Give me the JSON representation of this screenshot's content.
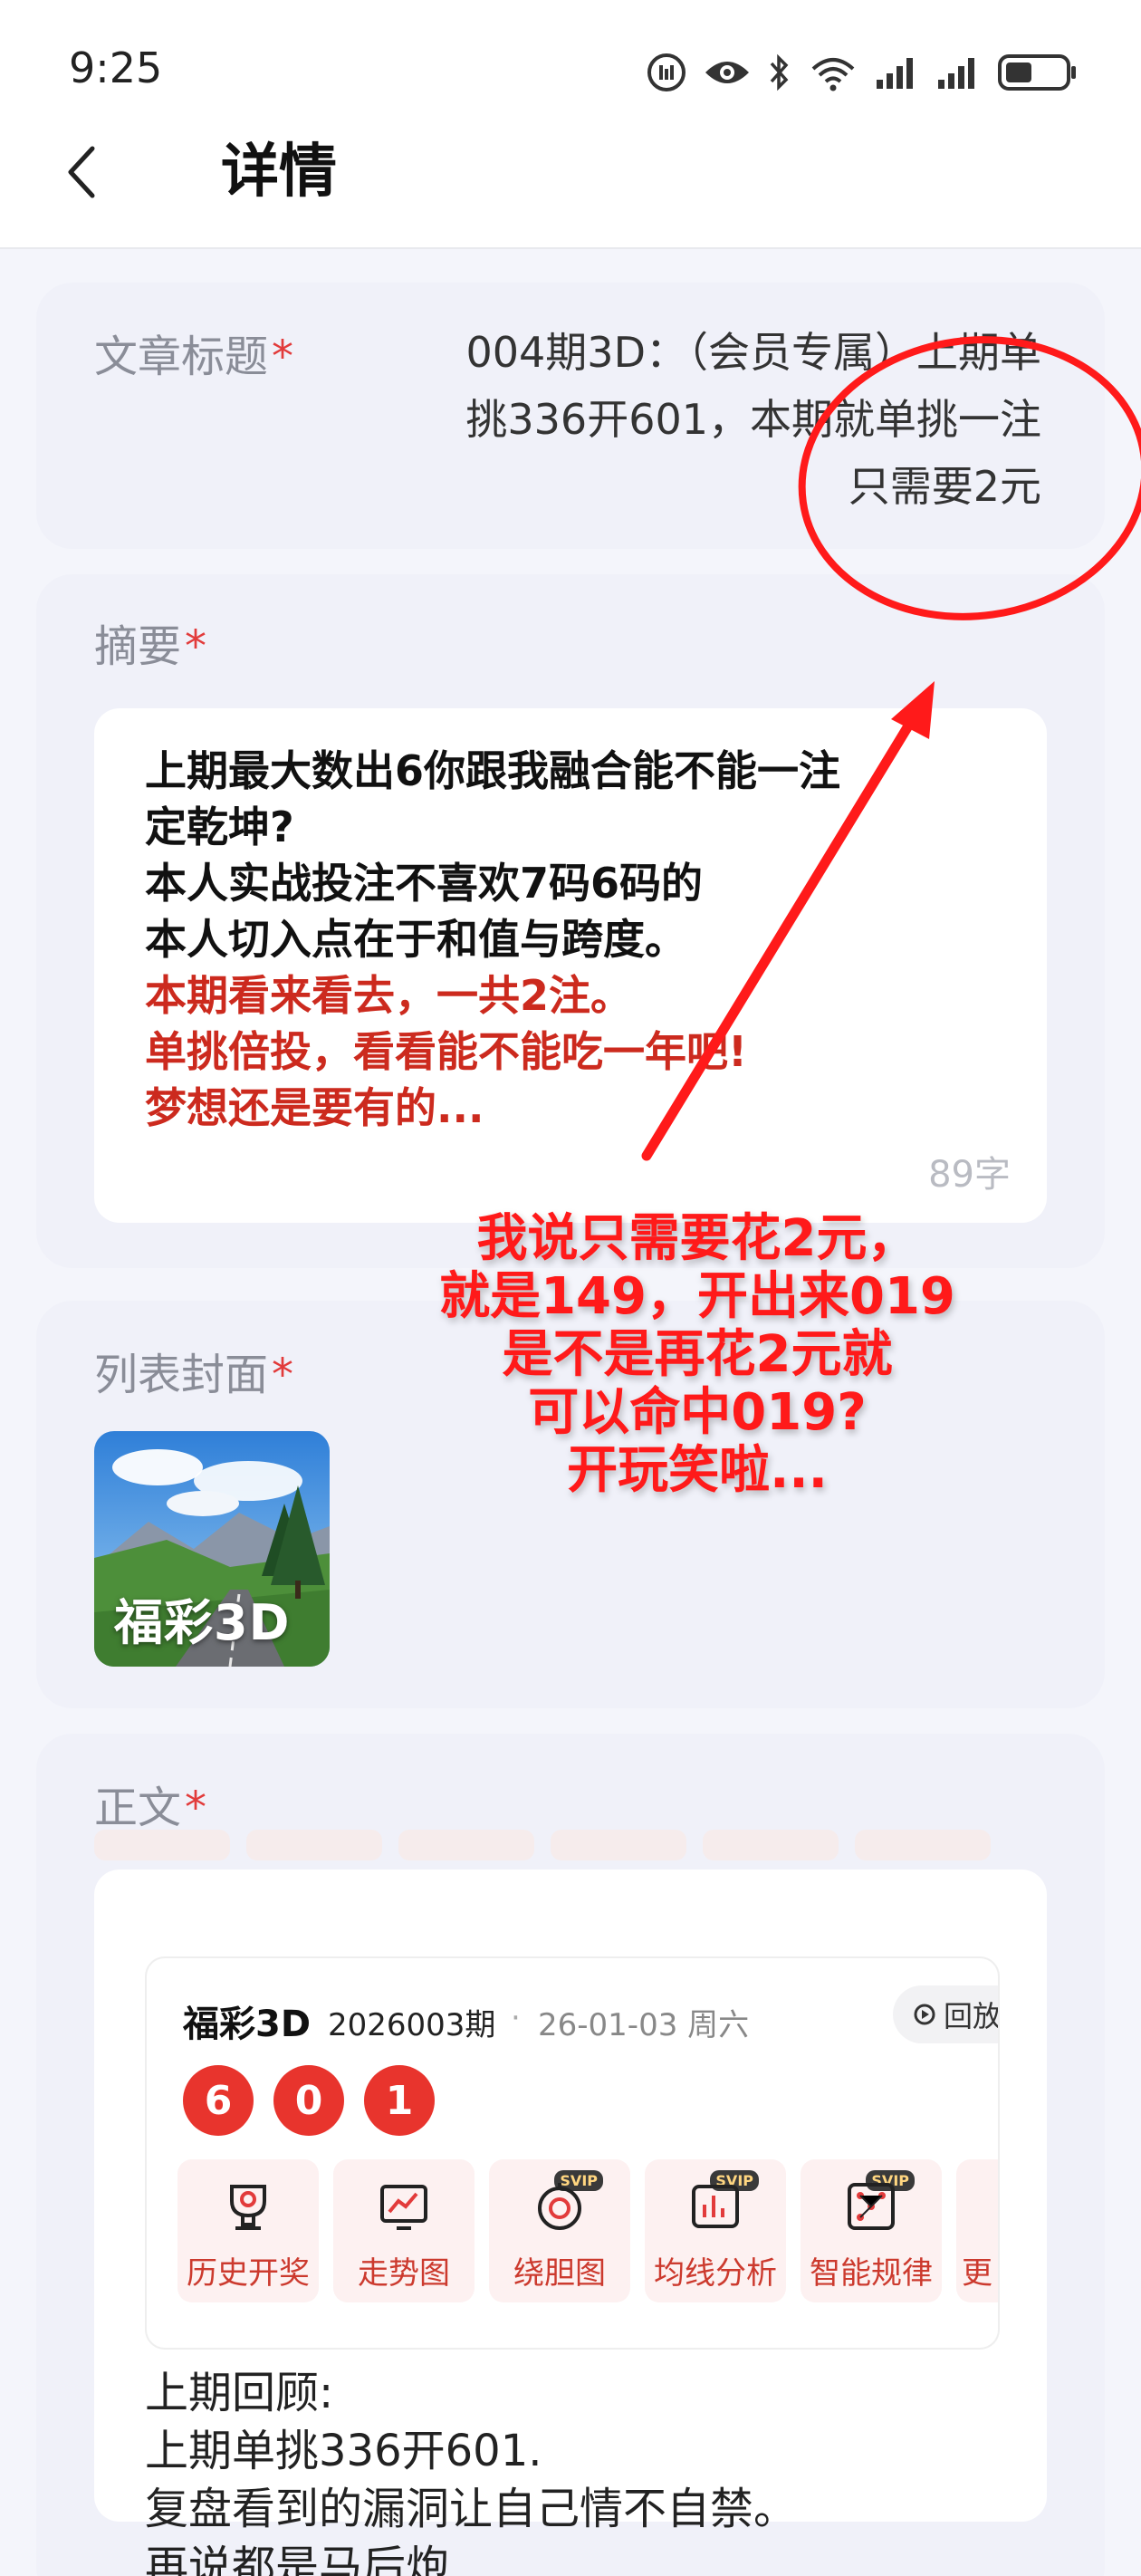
{
  "status_bar": {
    "time": "9:25"
  },
  "nav": {
    "title": "详情"
  },
  "article_title": {
    "label": "文章标题",
    "required_mark": "*",
    "lines": [
      "004期3D：（会员专属）上期单",
      "挑336开601，本期就单挑一注",
      "只需要2元"
    ]
  },
  "abstract": {
    "label": "摘要",
    "required_mark": "*",
    "lines_black": [
      "上期最大数出6你跟我融合能不能一注",
      "定乾坤?",
      "本人实战投注不喜欢7码6码的",
      "本人切入点在于和值与跨度。"
    ],
    "lines_red": [
      "本期看来看去，一共2注。",
      "单挑倍投，看看能不能吃一年吧!",
      "梦想还是要有的..."
    ],
    "char_count": "89字",
    "colors": {
      "black": "#111111",
      "red": "#cc2a1e"
    }
  },
  "cover": {
    "label": "列表封面",
    "required_mark": "*",
    "image_text": "福彩3D"
  },
  "body": {
    "label": "正文",
    "required_mark": "*",
    "lottery_card": {
      "name": "福彩3D",
      "period": "2026003期",
      "separator": "·",
      "date": "26-01-03 周六",
      "replay_label": "回放",
      "balls": [
        "6",
        "0",
        "1"
      ],
      "ball_color": "#e8342d",
      "tools": [
        {
          "label": "历史开奖",
          "icon": "trophy-icon",
          "svip": ""
        },
        {
          "label": "走势图",
          "icon": "trend-chart-icon",
          "svip": ""
        },
        {
          "label": "绕胆图",
          "icon": "circle-chart-icon",
          "svip": "SVIP"
        },
        {
          "label": "均线分析",
          "icon": "bar-chart-icon",
          "svip": "SVIP"
        },
        {
          "label": "智能规律",
          "icon": "ai-dots-icon",
          "svip": "SVIP"
        },
        {
          "label": "更",
          "icon": "more-icon",
          "svip": ""
        }
      ]
    },
    "text_lines": [
      "上期回顾:",
      "上期单挑336开601.",
      "复盘看到的漏洞让自己情不自禁。",
      "再说都是马后炮"
    ]
  },
  "annotation": {
    "lines": [
      "我说只需要花2元，",
      "就是149，开出来019",
      "是不是再花2元就",
      "可以命中019?",
      "开玩笑啦..."
    ],
    "color": "#ff1a1a"
  }
}
